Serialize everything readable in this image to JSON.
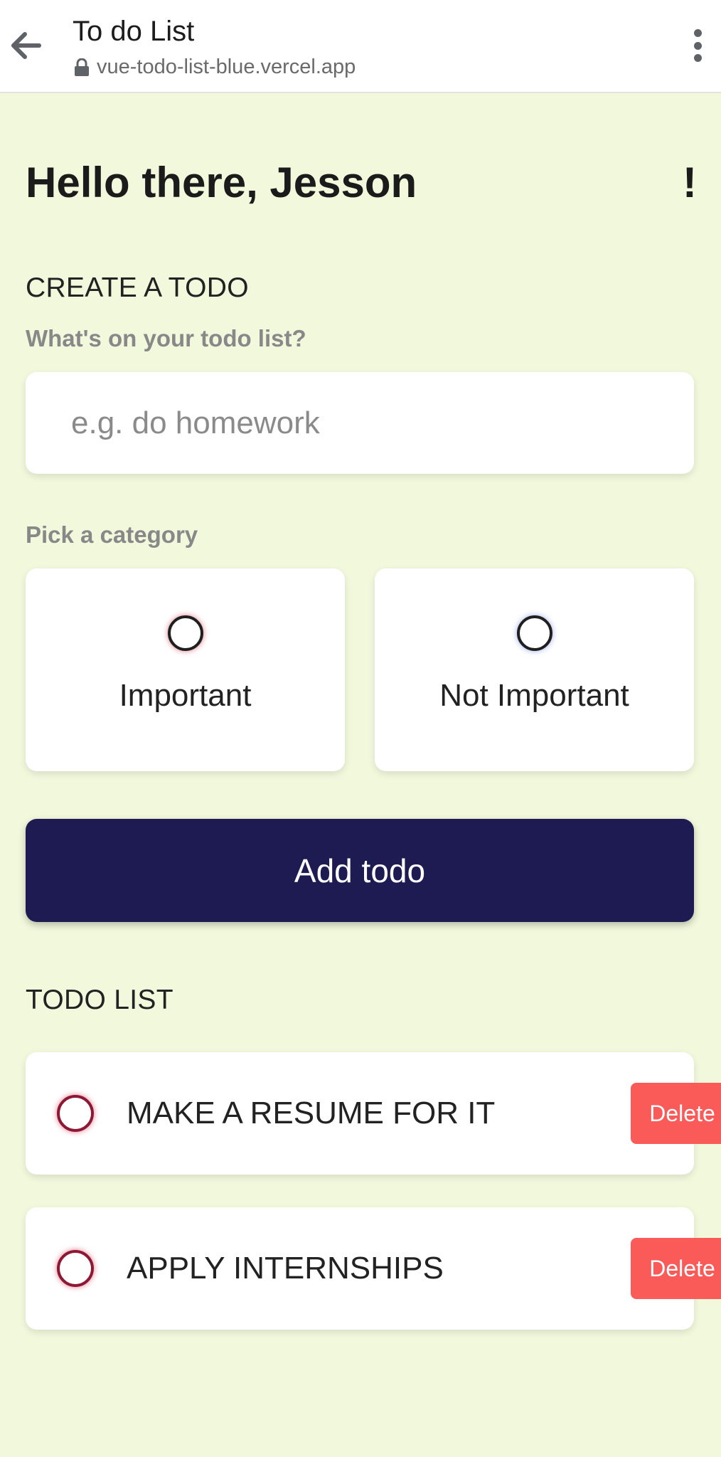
{
  "browser": {
    "title": "To do List",
    "url": "vue-todo-list-blue.vercel.app"
  },
  "greeting": {
    "text": "Hello there, Jesson",
    "mark": "!"
  },
  "create": {
    "section_title": "CREATE A TODO",
    "question": "What's on your todo list?",
    "input_placeholder": "e.g. do homework",
    "input_value": "",
    "category_label": "Pick a category",
    "categories": [
      {
        "label": "Important",
        "color": "#8e1734"
      },
      {
        "label": "Not Important",
        "color": "#5a63a8"
      }
    ],
    "add_label": "Add todo"
  },
  "list": {
    "section_title": "TODO LIST",
    "items": [
      {
        "text": "MAKE A RESUME FOR IT",
        "category": "Important",
        "delete_label": "Delete"
      },
      {
        "text": "APPLY INTERNSHIPS",
        "category": "Important",
        "delete_label": "Delete"
      }
    ]
  },
  "colors": {
    "page_background": "#f1f8dc",
    "primary_button": "#1d1b52",
    "delete_button": "#fb5b58"
  }
}
